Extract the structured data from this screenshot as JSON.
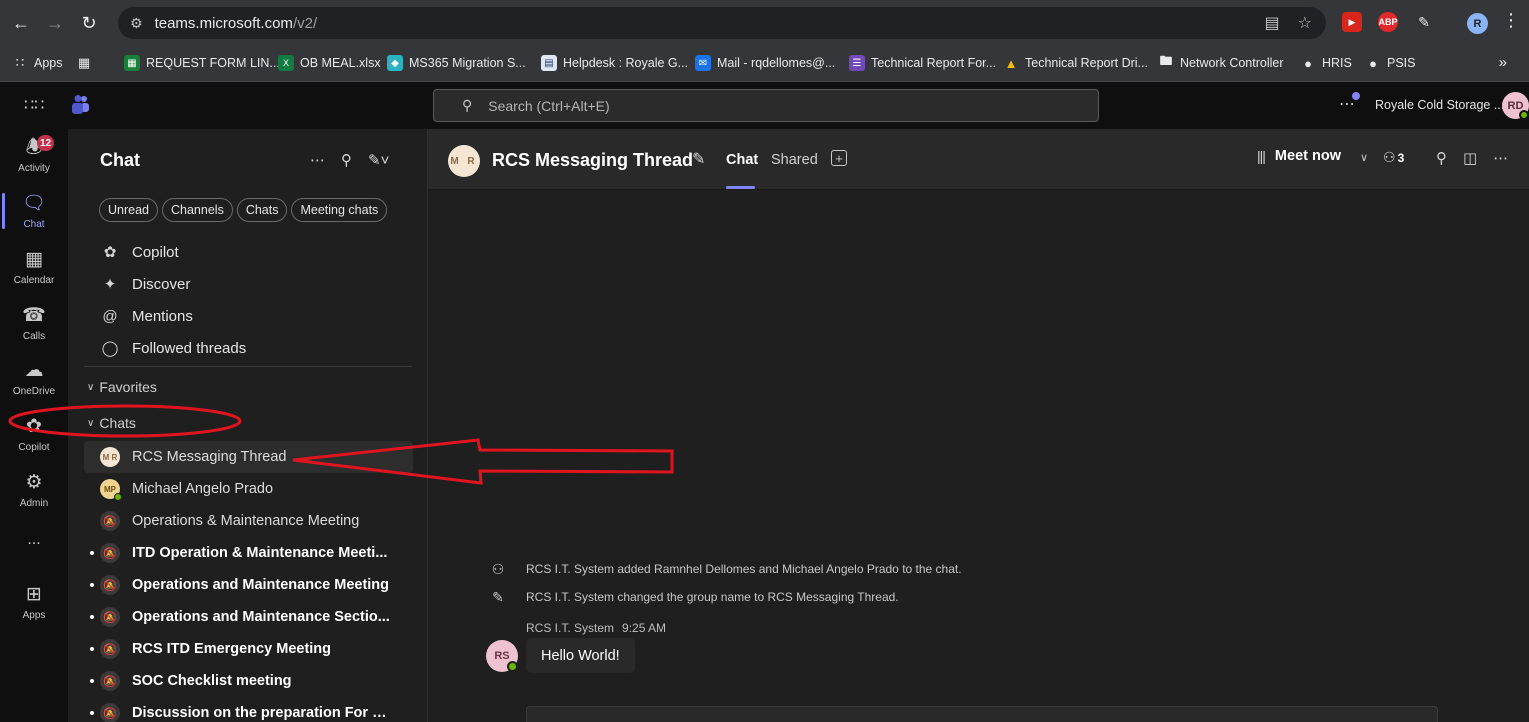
{
  "browser": {
    "url_host": "teams.microsoft.com",
    "url_path": "/v2/",
    "profile_initial": "R",
    "bookmarks": [
      {
        "label": "Apps",
        "icon": "apps-grid-icon",
        "color": "#e8eaed"
      },
      {
        "label": "",
        "icon": "tab-groups-icon",
        "color": "#e8eaed"
      },
      {
        "label": "REQUEST FORM LIN...",
        "icon": "sheets-icon",
        "color": "#188038"
      },
      {
        "label": "OB MEAL.xlsx",
        "icon": "excel-icon",
        "color": "#107c41"
      },
      {
        "label": "MS365 Migration S...",
        "icon": "migration-icon",
        "color": "#2bb3c0"
      },
      {
        "label": "Helpdesk : Royale G...",
        "icon": "helpdesk-icon",
        "color": "#dfe7f2"
      },
      {
        "label": "Mail - rqdellomes@...",
        "icon": "mail-icon",
        "color": "#1a73e8"
      },
      {
        "label": "Technical Report For...",
        "icon": "forms-icon",
        "color": "#7248b9"
      },
      {
        "label": "Technical Report Dri...",
        "icon": "drive-icon",
        "color": "#fbbc04"
      },
      {
        "label": "Network Controller",
        "icon": "folder-icon",
        "color": "#e8eaed"
      },
      {
        "label": "HRIS",
        "icon": "globe-icon",
        "color": "#e8eaed"
      },
      {
        "label": "PSIS",
        "icon": "globe-icon",
        "color": "#e8eaed"
      }
    ]
  },
  "teams_header": {
    "search_placeholder": "Search (Ctrl+Alt+E)",
    "org_name": "Royale Cold Storage ...",
    "me_initials": "RD"
  },
  "rail": {
    "items": [
      {
        "label": "Activity",
        "badge": "12"
      },
      {
        "label": "Chat"
      },
      {
        "label": "Calendar"
      },
      {
        "label": "Calls"
      },
      {
        "label": "OneDrive"
      },
      {
        "label": "Copilot"
      },
      {
        "label": "Admin"
      },
      {
        "label": "..."
      },
      {
        "label": "Apps"
      }
    ]
  },
  "list_pane": {
    "title": "Chat",
    "filters": [
      "Unread",
      "Channels",
      "Chats",
      "Meeting chats"
    ],
    "nav": [
      "Copilot",
      "Discover",
      "Mentions",
      "Followed threads"
    ],
    "favorites_label": "Favorites",
    "chats_label": "Chats",
    "chats": [
      {
        "name": "RCS Messaging Thread",
        "avatar": "M R",
        "selected": true,
        "unread": false
      },
      {
        "name": "Michael Angelo Prado",
        "avatar": "MP",
        "selected": false,
        "unread": false
      },
      {
        "name": "Operations & Maintenance Meeting",
        "avatar": "meeting",
        "selected": false,
        "unread": false
      },
      {
        "name": "ITD Operation & Maintenance Meeti...",
        "avatar": "meeting",
        "selected": false,
        "unread": true
      },
      {
        "name": "Operations and Maintenance Meeting",
        "avatar": "meeting",
        "selected": false,
        "unread": true
      },
      {
        "name": "Operations and Maintenance Sectio...",
        "avatar": "meeting",
        "selected": false,
        "unread": true
      },
      {
        "name": "RCS ITD Emergency Meeting",
        "avatar": "meeting",
        "selected": false,
        "unread": true
      },
      {
        "name": "SOC Checklist meeting",
        "avatar": "meeting",
        "selected": false,
        "unread": true
      },
      {
        "name": "Discussion on the preparation For U...",
        "avatar": "meeting",
        "selected": false,
        "unread": true
      }
    ]
  },
  "main": {
    "group_avatar": "M R",
    "title": "RCS Messaging Thread",
    "tabs": [
      "Chat",
      "Shared"
    ],
    "meet_now": "Meet now",
    "participants": "3",
    "system_events": [
      "RCS I.T. System added Ramnhel Dellomes and Michael Angelo Prado to the chat.",
      "RCS I.T. System changed the group name to RCS Messaging Thread."
    ],
    "message": {
      "sender": "RCS I.T. System",
      "time": "9:25 AM",
      "avatar": "RS",
      "text": "Hello World!"
    }
  },
  "colors": {
    "accent": "#7f85f5",
    "annotation_red": "#e0141e",
    "presence_available": "#6bb700",
    "badge_red": "#c4314b"
  }
}
